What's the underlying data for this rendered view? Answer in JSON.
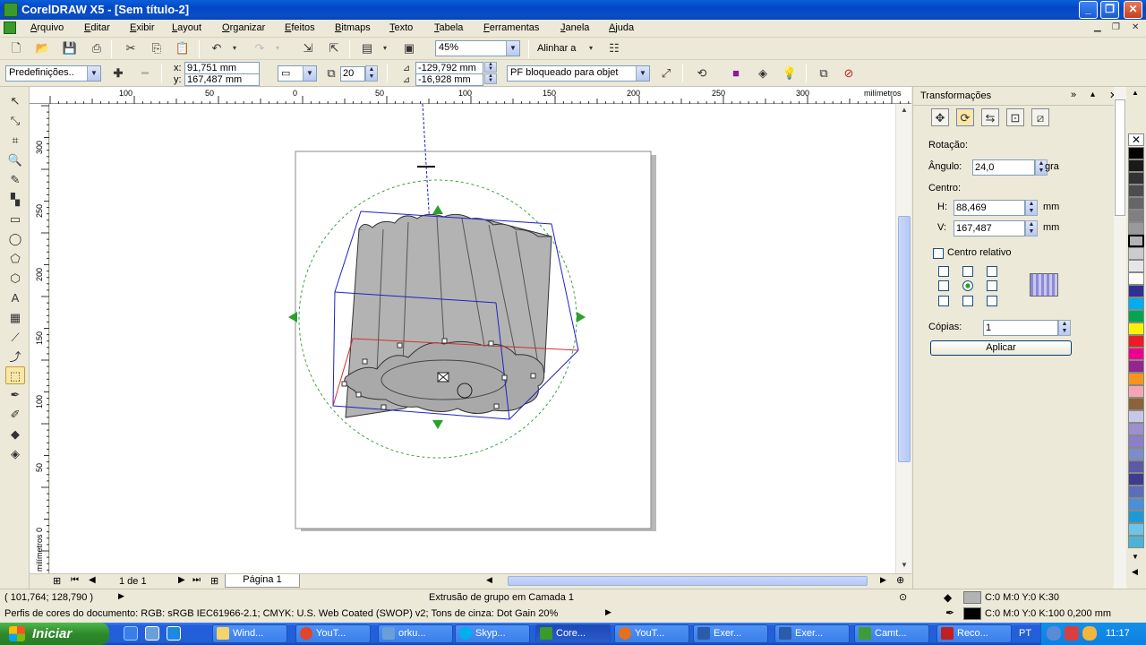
{
  "window": {
    "title": "CorelDRAW X5 - [Sem título-2]"
  },
  "menu": [
    "Arquivo",
    "Editar",
    "Exibir",
    "Layout",
    "Organizar",
    "Efeitos",
    "Bitmaps",
    "Texto",
    "Tabela",
    "Ferramentas",
    "Janela",
    "Ajuda"
  ],
  "toolbar": {
    "zoom": "45%",
    "align_label": "Alinhar a"
  },
  "propbar": {
    "preset": "Predefinições..",
    "x": "91,751 mm",
    "y": "167,487 mm",
    "depth": "20",
    "vp_x": "-129,792 mm",
    "vp_y": "-16,928 mm",
    "vp_lock": "PF bloqueado para objet"
  },
  "ruler": {
    "top_ticks": [
      "100",
      "50",
      "0",
      "50",
      "100",
      "150",
      "200",
      "250",
      "300"
    ],
    "unit": "milímetros",
    "left_ticks": [
      "300",
      "250",
      "200",
      "150",
      "100",
      "50",
      "0"
    ],
    "left_unit": "milímetros"
  },
  "pages": {
    "counter": "1 de 1",
    "tab": "Página 1"
  },
  "docker": {
    "title": "Transformações",
    "section": "Rotação:",
    "angle_label": "Ângulo:",
    "angle_value": "24,0",
    "angle_unit": "gra",
    "center_label": "Centro:",
    "h_label": "H:",
    "h_value": "88,469",
    "v_label": "V:",
    "v_value": "167,487",
    "unit": "mm",
    "relative_label": "Centro relativo",
    "copies_label": "Cópias:",
    "copies_value": "1",
    "apply_label": "Aplicar"
  },
  "status": {
    "coords": "( 101,764; 128,790 )",
    "object": "Extrusão de grupo em Camada 1",
    "profile": "Perfis de cores do documento: RGB: sRGB IEC61966-2.1; CMYK: U.S. Web Coated (SWOP) v2; Tons de cinza: Dot Gain 20%",
    "fill": "C:0 M:0 Y:0 K:30",
    "outline": "C:0 M:0 Y:0 K:100  0,200 mm"
  },
  "taskbar": {
    "start": "Iniciar",
    "tasks": [
      "Wind...",
      "YouT...",
      "orku...",
      "Skyp...",
      "Core...",
      "YouT...",
      "Exer...",
      "Exer...",
      "Camt...",
      "Reco..."
    ],
    "lang": "PT",
    "clock": "11:17"
  },
  "colors": {
    "accent": "#0a4fc7",
    "selection": "#2020c8",
    "extrude_red": "#d03030",
    "fill_gray": "#b3b3b3"
  }
}
